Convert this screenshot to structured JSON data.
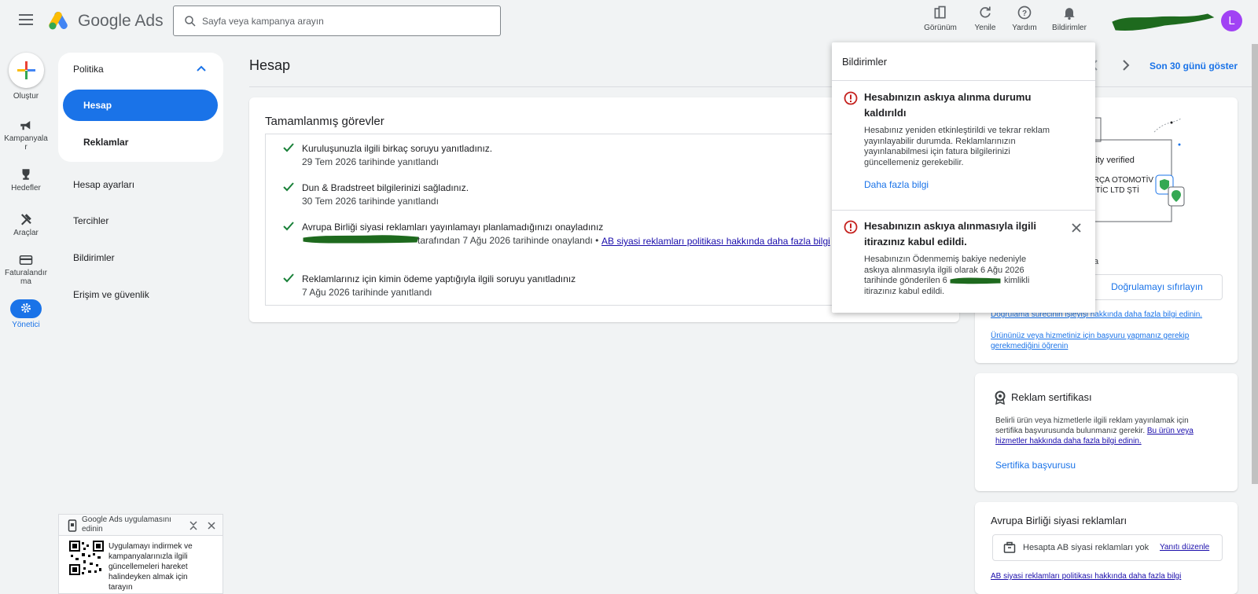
{
  "header": {
    "app_name": "Google Ads",
    "search_placeholder": "Sayfa veya kampanya arayın",
    "tools": [
      {
        "label": "Görünüm",
        "icon": "appearance-icon"
      },
      {
        "label": "Yenile",
        "icon": "refresh-icon"
      },
      {
        "label": "Yardım",
        "icon": "help-icon"
      },
      {
        "label": "Bildirimler",
        "icon": "bell-icon"
      }
    ],
    "avatar_letter": "L"
  },
  "rail": {
    "create": "Oluştur",
    "campaigns": "Kampanyalar",
    "goals": "Hedefler",
    "tools": "Araçlar",
    "billing": "Faturalandırma",
    "admin": "Yönetici"
  },
  "nav": {
    "section": "Politika",
    "active": "Hesap",
    "ads": "Reklamlar",
    "items": [
      "Hesap ayarları",
      "Tercihler",
      "Bildirimler",
      "Erişim ve güvenlik"
    ]
  },
  "main": {
    "title": "Hesap",
    "date_range": "Son 30 günü göster",
    "tasks_title": "Tamamlanmış görevler",
    "tasks": [
      {
        "title": "Kuruluşunuzla ilgili birkaç soruyu yanıtladınız.",
        "sub": "29 Tem 2026 tarihinde yanıtlandı"
      },
      {
        "title": "Dun & Bradstreet bilgilerinizi sağladınız.",
        "sub": "30 Tem 2026 tarihinde yanıtlandı"
      },
      {
        "title": "Avrupa Birliği siyasi reklamları yayınlamayı planlamadığınızı onayladınız",
        "sub": "tarafından 7 Ağu 2026 tarihinde onaylandı •",
        "link": "AB siyasi reklamları politikası hakkında daha fazla bilgi"
      },
      {
        "title": "Reklamlarınız için kimin ödeme yaptığıyla ilgili soruyu yanıtladınız",
        "sub": "7 Ağu 2026 tarihinde yanıtlandı"
      }
    ]
  },
  "verification_card": {
    "identity_text": "entity verified",
    "company_line1": "PARÇA OTOMOTİV",
    "company_line2": "AYİTİC LTD ŞTİ",
    "partial_text": "ta",
    "reset_button": "Doğrulamayı sıfırlayın",
    "link1": "Doğrulama sürecinin işleyişi hakkında daha fazla bilgi edinin.",
    "link2": "Ürününüz veya hizmetiniz için başvuru yapmanız gerekip gerekmediğini öğrenin"
  },
  "cert_card": {
    "title": "Reklam sertifikası",
    "body": "Belirli ürün veya hizmetlerle ilgili reklam yayınlamak için sertifika başvurusunda bulunmanız gerekir.",
    "body_link": "Bu ürün veya hizmetler hakkında daha fazla bilgi edinin.",
    "action": "Sertifika başvurusu"
  },
  "eu_card": {
    "title": "Avrupa Birliği siyasi reklamları",
    "status": "Hesapta AB siyasi reklamları yok",
    "edit_link": "Yanıtı düzenle",
    "policy_link": "AB siyasi reklamları politikası hakkında daha fazla bilgi"
  },
  "notifications": {
    "header": "Bildirimler",
    "items": [
      {
        "title": "Hesabınızın askıya alınma durumu kaldırıldı",
        "body": "Hesabınız yeniden etkinleştirildi ve tekrar reklam yayınlayabilir durumda. Reklamlarınızın yayınlanabilmesi için fatura bilgilerinizi güncellemeniz gerekebilir.",
        "link": "Daha fazla bilgi"
      },
      {
        "title": "Hesabınızın askıya alınmasıyla ilgili itirazınız kabul edildi.",
        "body_a": "Hesabınızın Ödenmemiş bakiye nedeniyle askıya alınmasıyla ilgili olarak 6 Ağu 2026 tarihinde gönderilen 6",
        "body_b": "kimlikli itirazınız kabul edildi."
      }
    ]
  },
  "promo": {
    "title": "Google Ads uygulamasını edinin",
    "body": "Uygulamayı indirmek ve kampanyalarınızla ilgili güncellemeleri hareket halindeyken almak için tarayın"
  },
  "colors": {
    "accent": "#1a73e8",
    "error": "#c5221f",
    "check": "#188038",
    "avatar": "#a142f4"
  }
}
